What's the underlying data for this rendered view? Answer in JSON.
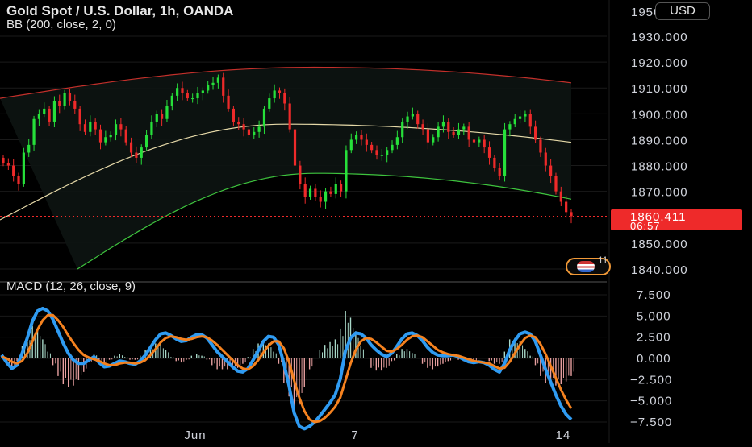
{
  "header": {
    "title": "Gold Spot / U.S. Dollar, 1h, OANDA",
    "indicator_label": "BB (200, close, 2, 0)",
    "currency_button": "USD",
    "macd_label": "MACD (12, 26, close, 9)"
  },
  "price_badge": {
    "price": "1860.411",
    "countdown": "06:57"
  },
  "events_badge": {
    "count": "11"
  },
  "colors": {
    "background": "#000000",
    "up_candle": "#26e03a",
    "down_candle": "#ee2a2a",
    "bb_upper": "#c4302b",
    "bb_basis": "#e6d9a8",
    "bb_lower": "#3ec43e",
    "macd_line": "#2f9bf2",
    "signal_line": "#f5821f",
    "hist_pos": "#a8d8c8",
    "hist_neg": "#e8a0a0",
    "grid": "#1a1a1a",
    "price_line": "#ee2a2a"
  },
  "chart_data": [
    {
      "type": "candlestick",
      "title": "Gold Spot / U.S. Dollar, 1h, OANDA",
      "x_ticks": [
        "Jun",
        "7",
        "14"
      ],
      "y_ticks": [
        1840,
        1850,
        1870,
        1880,
        1890,
        1900,
        1910,
        1920,
        1930
      ],
      "ylim": [
        1835,
        1950
      ],
      "last_price": 1860.411,
      "candles_close": [
        1881,
        1880,
        1876,
        1873,
        1885,
        1888,
        1898,
        1900,
        1902,
        1897,
        1905,
        1903,
        1908,
        1905,
        1902,
        1896,
        1893,
        1897,
        1894,
        1889,
        1891,
        1892,
        1896,
        1894,
        1889,
        1885,
        1883,
        1887,
        1892,
        1897,
        1900,
        1898,
        1903,
        1907,
        1910,
        1908,
        1906,
        1906,
        1908,
        1909,
        1911,
        1912,
        1914,
        1907,
        1902,
        1897,
        1896,
        1894,
        1892,
        1893,
        1895,
        1902,
        1906,
        1909,
        1908,
        1904,
        1894,
        1880,
        1873,
        1868,
        1871,
        1868,
        1866,
        1870,
        1869,
        1873,
        1870,
        1886,
        1890,
        1892,
        1890,
        1888,
        1886,
        1884,
        1884,
        1886,
        1888,
        1891,
        1897,
        1899,
        1900,
        1896,
        1894,
        1889,
        1891,
        1895,
        1897,
        1893,
        1892,
        1894,
        1895,
        1890,
        1889,
        1890,
        1887,
        1883,
        1879,
        1876,
        1894,
        1896,
        1898,
        1899,
        1900,
        1895,
        1890,
        1885,
        1880,
        1876,
        1870,
        1866,
        1862,
        1860.4
      ],
      "bollinger": {
        "period": 200,
        "upper_start": 1906,
        "upper_peak": 1918,
        "upper_end": 1912,
        "basis_start": 1859,
        "basis_mid": 1896,
        "basis_end": 1889,
        "lower_start": 1840,
        "lower_mid": 1877,
        "lower_end": 1867
      }
    },
    {
      "type": "line",
      "title": "MACD (12, 26, close, 9)",
      "y_ticks": [
        7.5,
        5.0,
        2.5,
        0.0,
        -2.5,
        -5.0,
        -7.5
      ],
      "ylim": [
        -8.5,
        8.5
      ],
      "series": [
        {
          "name": "MACD",
          "values": [
            0.4,
            -0.5,
            -1.2,
            -0.8,
            0.6,
            2.4,
            4.4,
            5.6,
            5.9,
            5.6,
            4.6,
            3.2,
            1.8,
            0.6,
            -0.2,
            -0.6,
            -0.6,
            -0.2,
            0.2,
            -0.5,
            -1.0,
            -0.9,
            -0.6,
            -0.3,
            -0.4,
            -0.6,
            -0.7,
            -0.3,
            0.4,
            1.3,
            2.2,
            2.9,
            3.0,
            2.7,
            2.3,
            2.0,
            2.1,
            2.5,
            2.8,
            2.8,
            2.4,
            1.6,
            0.8,
            0.2,
            -0.4,
            -1.0,
            -1.5,
            -1.6,
            -1.2,
            -0.2,
            0.9,
            2.0,
            2.6,
            2.5,
            1.6,
            -0.6,
            -3.2,
            -6.4,
            -8.0,
            -8.3,
            -8.0,
            -7.5,
            -6.8,
            -6.0,
            -5.2,
            -4.3,
            -2.4,
            0.9,
            2.4,
            3.0,
            2.9,
            2.4,
            1.6,
            1.0,
            0.5,
            0.2,
            0.6,
            1.4,
            2.3,
            2.9,
            3.0,
            2.7,
            2.1,
            1.3,
            0.7,
            0.4,
            0.3,
            0.3,
            0.4,
            0.2,
            -0.1,
            -0.4,
            -0.5,
            -0.4,
            -0.5,
            -0.8,
            -1.3,
            -1.6,
            -0.6,
            1.0,
            2.1,
            2.9,
            3.1,
            2.9,
            2.0,
            0.4,
            -1.3,
            -2.8,
            -4.3,
            -5.6,
            -6.6,
            -7.2
          ]
        },
        {
          "name": "Signal",
          "values": [
            0.2,
            0.0,
            -0.4,
            -0.6,
            -0.3,
            0.6,
            2.0,
            3.4,
            4.5,
            5.1,
            5.1,
            4.5,
            3.7,
            2.7,
            1.8,
            1.0,
            0.4,
            0.1,
            -0.1,
            -0.3,
            -0.6,
            -0.8,
            -0.8,
            -0.6,
            -0.5,
            -0.5,
            -0.6,
            -0.5,
            -0.2,
            0.4,
            1.1,
            1.9,
            2.4,
            2.6,
            2.5,
            2.3,
            2.2,
            2.3,
            2.5,
            2.6,
            2.5,
            2.1,
            1.6,
            1.0,
            0.4,
            -0.2,
            -0.8,
            -1.2,
            -1.3,
            -0.9,
            -0.2,
            0.7,
            1.5,
            2.0,
            2.0,
            1.2,
            -0.4,
            -2.6,
            -4.6,
            -6.2,
            -7.2,
            -7.5,
            -7.4,
            -7.0,
            -6.4,
            -5.7,
            -4.6,
            -2.6,
            -0.6,
            1.0,
            2.0,
            2.4,
            2.3,
            1.9,
            1.4,
            0.9,
            0.8,
            1.1,
            1.6,
            2.2,
            2.6,
            2.7,
            2.5,
            2.0,
            1.5,
            1.0,
            0.7,
            0.5,
            0.4,
            0.3,
            0.1,
            -0.1,
            -0.3,
            -0.4,
            -0.5,
            -0.6,
            -0.9,
            -1.2,
            -1.1,
            -0.4,
            0.6,
            1.6,
            2.4,
            2.7,
            2.5,
            1.7,
            0.5,
            -0.9,
            -2.3,
            -3.7,
            -4.9,
            -5.9
          ]
        }
      ]
    }
  ]
}
